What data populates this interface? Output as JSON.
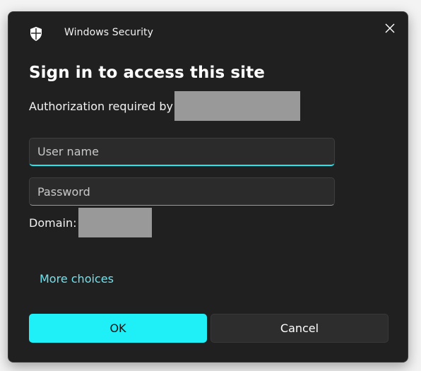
{
  "window": {
    "title": "Windows Security",
    "icon": "shield-icon"
  },
  "dialog": {
    "heading": "Sign in to access this site",
    "auth_required_label": "Authorization required by",
    "username": {
      "placeholder": "User name",
      "value": ""
    },
    "password": {
      "placeholder": "Password",
      "value": ""
    },
    "domain_label": "Domain:",
    "more_choices": "More choices",
    "ok_label": "OK",
    "cancel_label": "Cancel"
  },
  "colors": {
    "accent": "#1ff0f7",
    "link": "#6fe3ee",
    "background": "#202020"
  }
}
